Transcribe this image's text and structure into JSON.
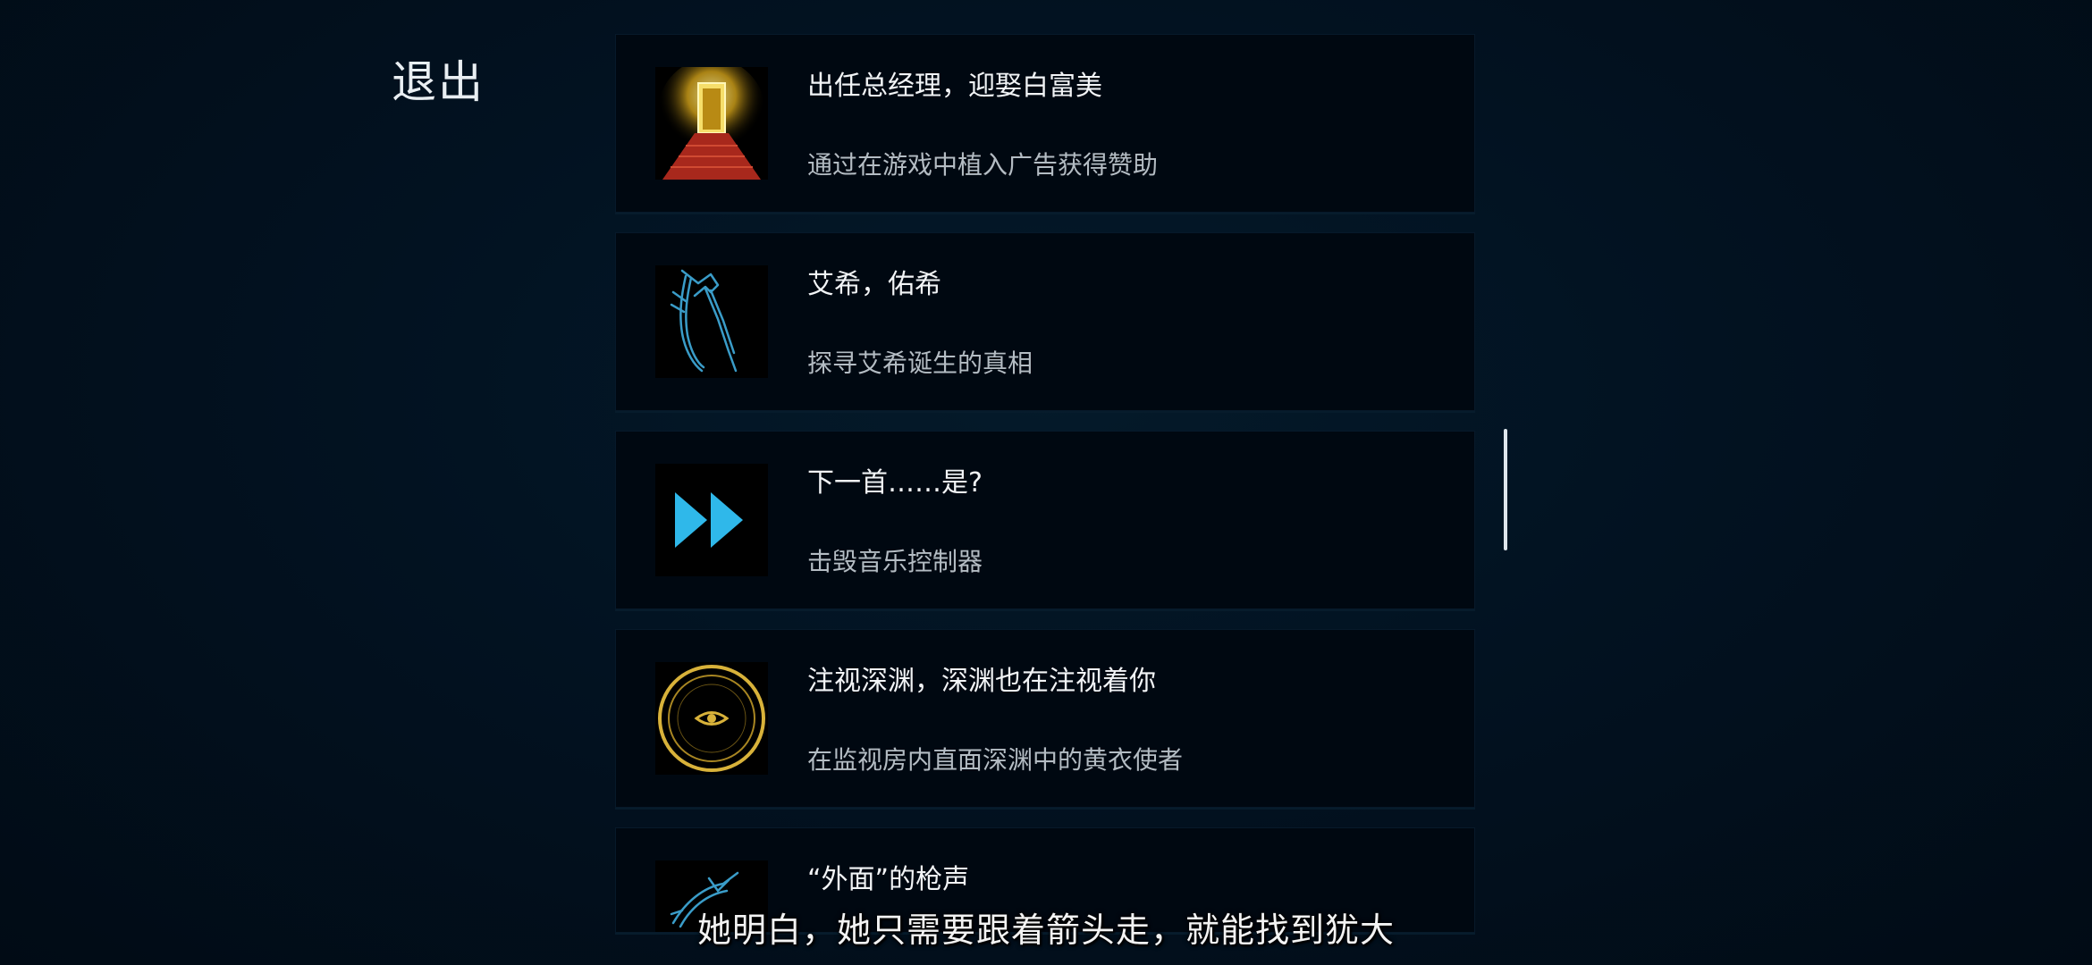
{
  "header": {
    "exit_label": "退出"
  },
  "achievements": [
    {
      "title": "出任总经理，迎娶白富美",
      "description": "通过在游戏中植入广告获得赞助",
      "icon": "golden-doorway-red-carpet-icon"
    },
    {
      "title": "艾希，佑希",
      "description": "探寻艾希诞生的真相",
      "icon": "scythe-blade-icon"
    },
    {
      "title": "下一首……是?",
      "description": "击毁音乐控制器",
      "icon": "fast-forward-icon"
    },
    {
      "title": "注视深渊，深渊也在注视着你",
      "description": "在监视房内直面深渊中的黄衣使者",
      "icon": "eye-ring-icon"
    },
    {
      "title": "“外面”的枪声",
      "description": "",
      "icon": "blue-blade-icon"
    }
  ],
  "subtitle": "她明白，她只需要跟着箭头走，就能找到犹大",
  "colors": {
    "background": "#02101c",
    "card": "#000811",
    "accent_blue": "#2fb8ea",
    "accent_gold": "#d8b23a",
    "carpet_red": "#a8281c"
  }
}
